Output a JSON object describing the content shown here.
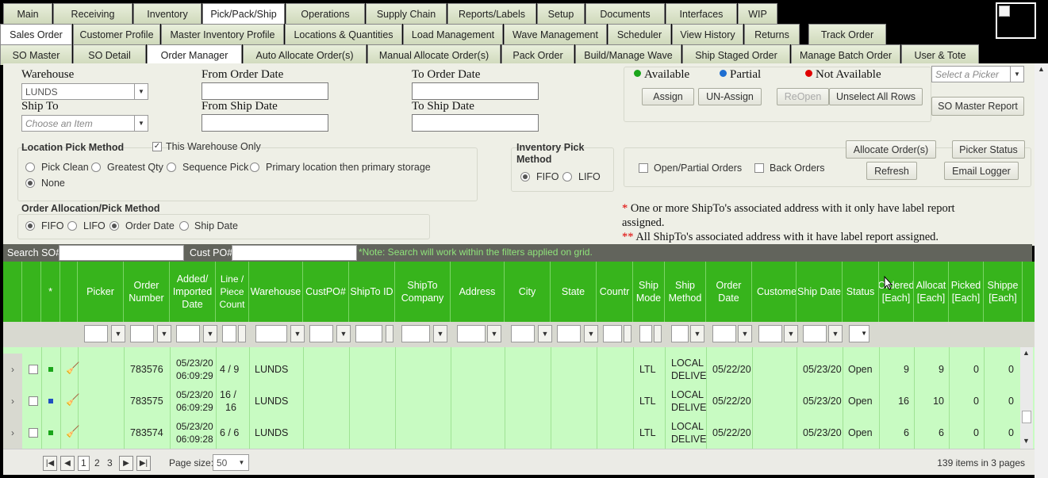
{
  "nav": {
    "row1": [
      "Main",
      "Receiving",
      "Inventory",
      "Pick/Pack/Ship",
      "Operations",
      "Supply Chain",
      "Reports/Labels",
      "Setup",
      "Documents",
      "Interfaces",
      "WIP"
    ],
    "row2": [
      "Sales Order",
      "Customer Profile",
      "Master Inventory Profile",
      "Locations & Quantities",
      "Load Management",
      "Wave Management",
      "Scheduler",
      "View History",
      "Returns",
      "Track Order"
    ],
    "row3": [
      "SO Master",
      "SO Detail",
      "Order Manager",
      "Auto Allocate Order(s)",
      "Manual Allocate Order(s)",
      "Pack Order",
      "Build/Manage Wave",
      "Ship Staged Order",
      "Manage Batch Order",
      "User & Tote"
    ]
  },
  "filters": {
    "warehouse_label": "Warehouse",
    "warehouse_value": "LUNDS",
    "ship_to_label": "Ship To",
    "ship_to_placeholder": "Choose an Item",
    "from_order_date_label": "From Order Date",
    "to_order_date_label": "To Order Date",
    "from_ship_date_label": "From Ship Date",
    "to_ship_date_label": "To Ship Date"
  },
  "legend": {
    "available": "Available",
    "partial": "Partial",
    "not_available": "Not Available"
  },
  "legend_colors": {
    "available": "#1aa51a",
    "partial": "#1f6fd1",
    "not_available": "#e00000"
  },
  "picker_placeholder": "Select a Picker",
  "buttons": {
    "assign": "Assign",
    "unassign": "UN-Assign",
    "reopen": "ReOpen",
    "unselect_all": "Unselect All Rows",
    "so_master_report": "SO Master Report",
    "allocate_orders": "Allocate Order(s)",
    "picker_status": "Picker Status",
    "refresh": "Refresh",
    "email_logger": "Email Logger"
  },
  "location_pick": {
    "title": "Location Pick Method",
    "this_warehouse_only": "This Warehouse Only",
    "options": [
      "Pick Clean",
      "Greatest Qty",
      "Sequence Pick",
      "Primary location then primary storage",
      "None"
    ]
  },
  "inventory_pick": {
    "title_line1": "Inventory Pick",
    "title_line2": "Method",
    "fifo": "FIFO",
    "lifo": "LIFO"
  },
  "order_checks": {
    "open_partial": "Open/Partial Orders",
    "back_orders": "Back Orders"
  },
  "order_allocation": {
    "title": "Order Allocation/Pick Method",
    "options": [
      "FIFO",
      "LIFO",
      "Order Date",
      "Ship Date"
    ]
  },
  "notes": {
    "one_star": "*",
    "one_text_line1": " One or more ShipTo's associated address with it only have label report",
    "one_text_line2": "assigned.",
    "two_star": "**",
    "two_text": " All ShipTo's associated address with it have label report assigned."
  },
  "search": {
    "so_label": "Search SO#",
    "po_label": "Cust PO#",
    "note": "*Note: Search will work within the filters applied on grid."
  },
  "grid": {
    "star": "*",
    "headers": {
      "picker": "Picker",
      "order_number": "Order Number",
      "added": "Added/ Imported Date",
      "line": "Line / Piece Count",
      "warehouse": "Warehouse",
      "custpo": "CustPO#",
      "shipto_id": "ShipTo ID",
      "shipto_company": "ShipTo Company",
      "address": "Address",
      "city": "City",
      "state": "State",
      "country": "Countr",
      "ship_mode": "Ship Mode",
      "ship_method": "Ship Method",
      "order_date": "Order Date",
      "customer": "Customer",
      "ship_date": "Ship Date",
      "status": "Status",
      "ordered": "Ordered [Each]",
      "allocated": "Allocat [Each]",
      "picked": "Picked [Each]",
      "shipped": "Shippe [Each]"
    },
    "rows": [
      {
        "order": "783576",
        "added1": "05/23/20",
        "added2": "06:09:29",
        "line1": "4 / 9",
        "line2": "",
        "warehouse": "LUNDS",
        "mode": "LTL",
        "method1": "LOCAL",
        "method2": "DELIVER",
        "order_date": "05/22/20",
        "ship_date": "05/23/20",
        "status": "Open",
        "ordered": "9",
        "allocated": "9",
        "picked": "0",
        "shipped": "0",
        "color": "#1aa51a"
      },
      {
        "order": "783575",
        "added1": "05/23/20",
        "added2": "06:09:29",
        "line1": "16 /",
        "line2": "16",
        "warehouse": "LUNDS",
        "mode": "LTL",
        "method1": "LOCAL",
        "method2": "DELIVER",
        "order_date": "05/22/20",
        "ship_date": "05/23/20",
        "status": "Open",
        "ordered": "16",
        "allocated": "10",
        "picked": "0",
        "shipped": "0",
        "color": "#1f4fc1"
      },
      {
        "order": "783574",
        "added1": "05/23/20",
        "added2": "06:09:28",
        "line1": "6 / 6",
        "line2": "",
        "warehouse": "LUNDS",
        "mode": "LTL",
        "method1": "LOCAL",
        "method2": "DELIVER",
        "order_date": "05/22/20",
        "ship_date": "05/23/20",
        "status": "Open",
        "ordered": "6",
        "allocated": "6",
        "picked": "0",
        "shipped": "0",
        "color": "#1aa51a"
      }
    ]
  },
  "pager": {
    "pages": [
      "1",
      "2",
      "3"
    ],
    "page_size_label": "Page size:",
    "page_size": "50",
    "summary": "139 items in 3 pages"
  }
}
